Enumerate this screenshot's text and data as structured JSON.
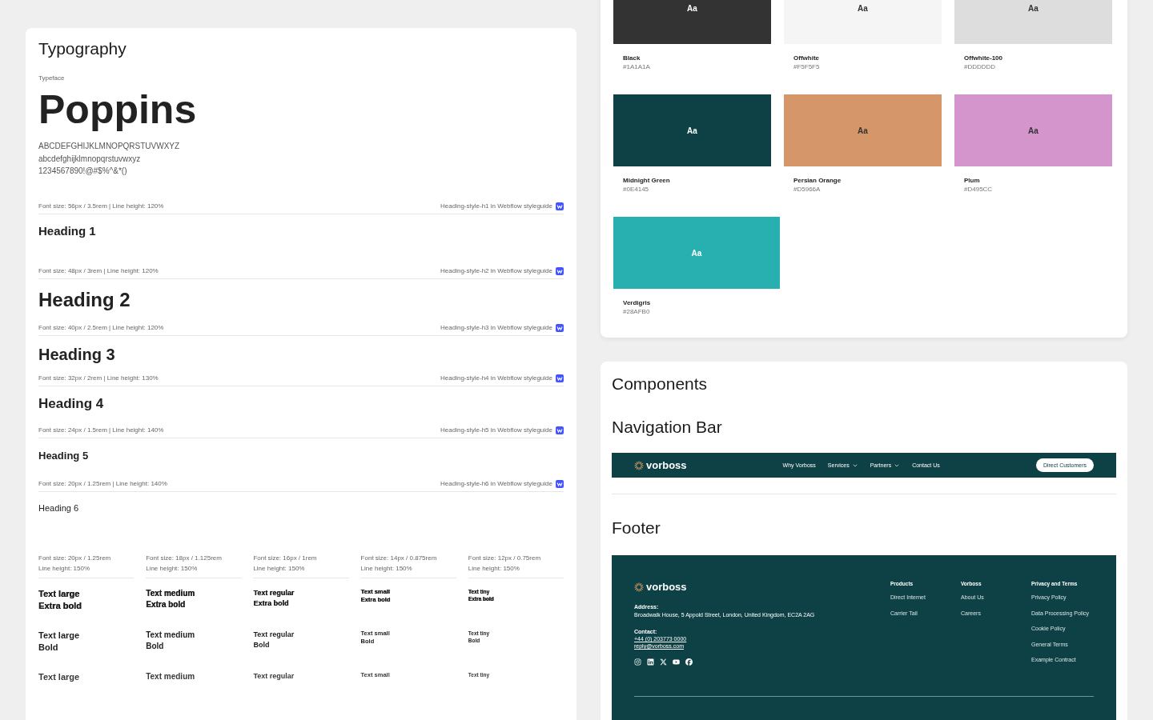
{
  "typography": {
    "title": "Typography",
    "typeface_label": "Typeface",
    "typeface": "Poppins",
    "charset": [
      "ABCDEFGHIJKLMNOPQRSTUVWXYZ",
      "abcdefghijklmnopqrstuvwxyz",
      "1234567890!@#$%^&*()"
    ],
    "headings": [
      {
        "kind": "h1",
        "spec": "Font size: 56px / 3.5rem | Line height: 120%",
        "source": "Heading-style-h1 in Webflow styleguide",
        "sample": "Heading 1"
      },
      {
        "kind": "h2",
        "spec": "Font size: 48px / 3rem | Line height: 120%",
        "source": "Heading-style-h2 in Webflow styleguide",
        "sample": "Heading 2"
      },
      {
        "kind": "h3",
        "spec": "Font size: 40px / 2.5rem | Line height: 120%",
        "source": "Heading-style-h3 in Webflow styleguide",
        "sample": "Heading 3"
      },
      {
        "kind": "h4",
        "spec": "Font size: 32px / 2rem | Line height: 130%",
        "source": "Heading-style-h4 in Webflow styleguide",
        "sample": "Heading 4"
      },
      {
        "kind": "h5",
        "spec": "Font size: 24px / 1.5rem | Line height: 140%",
        "source": "Heading-style-h5 in Webflow styleguide",
        "sample": "Heading 5"
      },
      {
        "kind": "h6",
        "spec": "Font size: 20px / 1.25rem | Line height: 140%",
        "source": "Heading-style-h6 in Webflow styleguide",
        "sample": "Heading 6"
      }
    ],
    "text_styles": [
      {
        "spec": [
          "Font size: 20px / 1.25rem",
          "Line height: 150%"
        ],
        "samples": [
          {
            "kind": "extrabold",
            "lines": [
              "Text large",
              "Extra bold"
            ]
          },
          {
            "kind": "bold",
            "lines": [
              "Text large",
              "Bold"
            ]
          },
          {
            "kind": "semibold",
            "lines": [
              "Text large"
            ]
          }
        ]
      },
      {
        "spec": [
          "Font size: 18px / 1.125rem",
          "Line height: 150%"
        ],
        "samples": [
          {
            "kind": "extrabold",
            "lines": [
              "Text medium",
              "Extra bold"
            ]
          },
          {
            "kind": "bold",
            "lines": [
              "Text medium",
              "Bold"
            ]
          },
          {
            "kind": "semibold",
            "lines": [
              "Text medium"
            ]
          }
        ]
      },
      {
        "spec": [
          "Font size: 16px / 1rem",
          "Line height: 150%"
        ],
        "samples": [
          {
            "kind": "extrabold",
            "lines": [
              "Text regular",
              "Extra bold"
            ]
          },
          {
            "kind": "bold",
            "lines": [
              "Text regular",
              "Bold"
            ]
          },
          {
            "kind": "semibold",
            "lines": [
              "Text regular"
            ]
          }
        ]
      },
      {
        "spec": [
          "Font size: 14px / 0.875rem",
          "Line height: 150%"
        ],
        "samples": [
          {
            "kind": "extrabold",
            "lines": [
              "Text small",
              "Extra bold"
            ]
          },
          {
            "kind": "bold",
            "lines": [
              "Text small",
              "Bold"
            ]
          },
          {
            "kind": "semibold",
            "lines": [
              "Text small"
            ]
          }
        ]
      },
      {
        "spec": [
          "Font size: 12px / 0.75rem",
          "Line height: 150%"
        ],
        "samples": [
          {
            "kind": "extrabold",
            "lines": [
              "Text tiny",
              "Extra bold"
            ]
          },
          {
            "kind": "bold",
            "lines": [
              "Text tiny",
              "Bold"
            ]
          },
          {
            "kind": "semibold",
            "lines": [
              "Text tiny"
            ]
          }
        ]
      }
    ]
  },
  "colors": [
    {
      "sample": "Aa",
      "name": "Black",
      "hex": "#1A1A1A",
      "color": "#333333"
    },
    {
      "sample": "Aa",
      "name": "Offwhite",
      "hex": "#F5F5F5",
      "color": "#f5f5f5"
    },
    {
      "sample": "Aa",
      "name": "Offwhite-100",
      "hex": "#DDDDDD",
      "color": "#dddddd"
    },
    {
      "sample": "Aa",
      "name": "Midnight Green",
      "hex": "#0E4145",
      "color": "#0e4145"
    },
    {
      "sample": "Aa",
      "name": "Persian Orange",
      "hex": "#D5966A",
      "color": "#d5966a"
    },
    {
      "sample": "Aa",
      "name": "Plum",
      "hex": "#D495CC",
      "color": "#d495cc"
    },
    {
      "sample": "Aa",
      "name": "Verdigris",
      "hex": "#28AFB0",
      "color": "#28afb0"
    }
  ],
  "components": {
    "title": "Components",
    "navbar_title": "Navigation Bar",
    "navbar": {
      "brand": "vorboss",
      "links": [
        {
          "label": "Why Vorboss",
          "dropdown": false
        },
        {
          "label": "Services",
          "dropdown": true
        },
        {
          "label": "Partners",
          "dropdown": true
        },
        {
          "label": "Contact Us",
          "dropdown": false
        }
      ],
      "button": "Direct Customers"
    },
    "footer_title": "Footer",
    "footer": {
      "brand": "vorboss",
      "address_label": "Address:",
      "address": "Broadwalk House, 5 Appold Street, London, United Kingdom, EC2A 2AG",
      "contact_label": "Contact:",
      "phone": "+44 (0) 203773 0000",
      "email": "reply@vorboss.com",
      "social": [
        {
          "kind": "instagram"
        },
        {
          "kind": "linkedin"
        },
        {
          "kind": "x"
        },
        {
          "kind": "youtube"
        },
        {
          "kind": "facebook"
        }
      ],
      "columns": [
        {
          "heading": "Products",
          "links": [
            "Direct Internet",
            "Carrier Tail"
          ]
        },
        {
          "heading": "Vorboss",
          "links": [
            "About Us",
            "Careers"
          ]
        },
        {
          "heading": "Privacy and Terms",
          "links": [
            "Privacy Policy",
            "Data Processing Policy",
            "Cookie Policy",
            "General Terms",
            "Example Contract"
          ]
        }
      ]
    }
  }
}
